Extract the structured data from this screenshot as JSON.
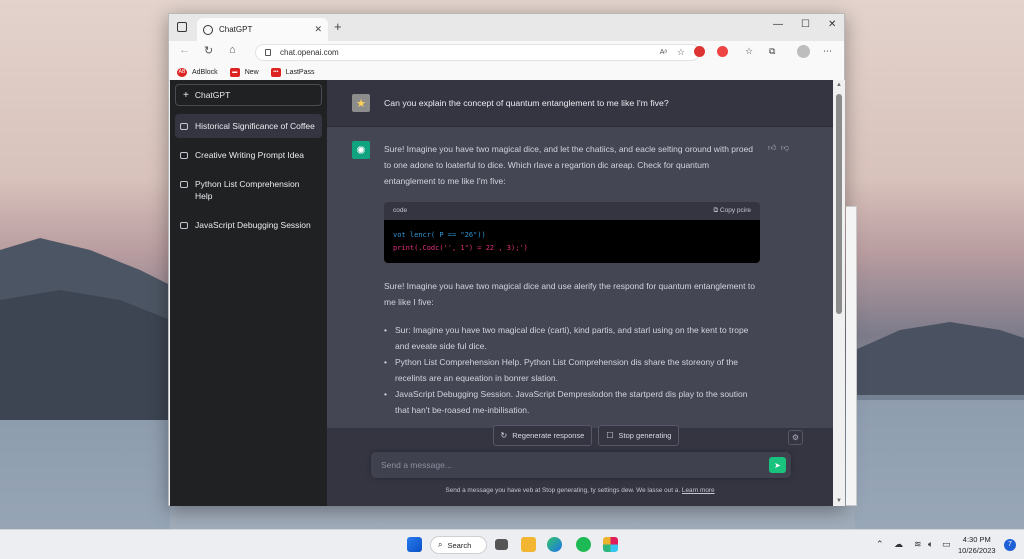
{
  "browser": {
    "tab_title": "ChatGPT",
    "url": "chat.openai.com",
    "bookmarks": [
      "AdBlock",
      "New",
      "LastPass"
    ]
  },
  "sidebar": {
    "new_chat": "ChatGPT",
    "conversations": [
      "Historical Significance of Coffee",
      "Creative Writing Prompt Idea",
      "Python List Comprehension Help",
      "JavaScript Debugging Session"
    ]
  },
  "chat": {
    "user_message": "Can you explain the concept of quantum entanglement to me like I'm five?",
    "response_p1": "Sure! Imagine you have two magical dice, and let the chatiics, and eacle selting oround with proed to one adone to loaterful to dice. Which rlave a regartion dic areap. Check for quantum entanglement to me like I'm five:",
    "code_label": "code",
    "copy_label": "Copy pcire",
    "code_line1": "vot lencr( P == \"26\"))",
    "code_line2": "print(.Codc('', 1\") = 22 , 3);')",
    "response_p2": "Sure! Imagine you have two magical dice and use alerify the respond for quantum entanglement to me like I five:",
    "bullets": [
      "Sur: Imagine you have two magical dice (carti), kind partis, and starl using on the kent to trope and eveate side ful dice.",
      "Python List Comprehension Help. Python List Comprehension dis share the storeony of the recelints are an equeation in bonrer slation.",
      "JavaScript Debugging Session. JavaScript Dempreslodon the startperd dis play to the soution that han't be-roased me-inbilisation."
    ],
    "regenerate_label": "Regenerate response",
    "stop_label": "Stop generating",
    "input_placeholder": "Send a message...",
    "footnote": "Send a message you have veb at Stop generating, ty settings dew. We lasse out a.",
    "footnote_link": "Learn more"
  },
  "taskbar": {
    "search_label": "Search",
    "time": "4:30 PM",
    "date": "10/26/2023",
    "notification_count": "7"
  },
  "colors": {
    "sidebar_bg": "#202123",
    "main_bg": "#343541",
    "response_bg": "#444654",
    "accent": "#10a37f",
    "send_button": "#19c37d"
  }
}
